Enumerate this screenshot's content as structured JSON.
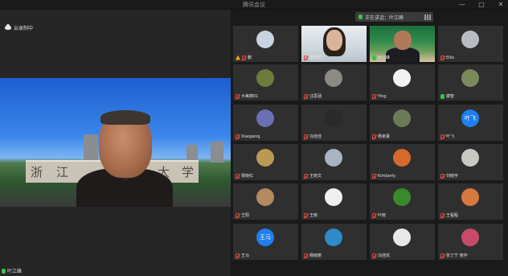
{
  "window": {
    "title": "腾讯会议"
  },
  "recording": {
    "label": "云录制中"
  },
  "self": {
    "name": "叶江峰"
  },
  "speaker": {
    "label": "正在讲话：叶江峰"
  },
  "participants": [
    {
      "name": "鹏",
      "avatar_color": "#c9d2e0",
      "mic": "red",
      "warn": true
    },
    {
      "name": "李晓华",
      "avatar_color": "#d9b39a",
      "mic": "red",
      "video": "woman"
    },
    {
      "name": "叶江峰",
      "avatar_color": "#b07a5a",
      "mic": "green",
      "video": "man"
    },
    {
      "name": "Ellis",
      "avatar_color": "#b8bcc2",
      "mic": "red"
    },
    {
      "name": "大美丽01",
      "avatar_color": "#6c7c3c",
      "mic": "red"
    },
    {
      "name": "汪思涵",
      "avatar_color": "#8d8a86",
      "mic": "red"
    },
    {
      "name": "Ying",
      "avatar_color": "#f2f2f2",
      "mic": "red"
    },
    {
      "name": "康智",
      "avatar_color": "#7a8a5a",
      "mic": "green"
    },
    {
      "name": "Xiaopeng",
      "avatar_color": "#6b6fb3",
      "mic": "red"
    },
    {
      "name": "冯佳佳",
      "avatar_color": "#2a2a2a",
      "mic": "red"
    },
    {
      "name": "杨家豪",
      "avatar_color": "#6b7b5a",
      "mic": "red"
    },
    {
      "name": "叶飞",
      "avatar_color": "#1f7ff0",
      "mic": "red",
      "initials": "叶飞"
    },
    {
      "name": "梁晓红",
      "avatar_color": "#b99a50",
      "mic": "red"
    },
    {
      "name": "王晓文",
      "avatar_color": "#a8b4c4",
      "mic": "red"
    },
    {
      "name": "Kimberly",
      "avatar_color": "#d46a2c",
      "mic": "red"
    },
    {
      "name": "刘晓宇",
      "avatar_color": "#c7c9c2",
      "mic": "red"
    },
    {
      "name": "王阳",
      "avatar_color": "#b58a60",
      "mic": "red"
    },
    {
      "name": "王晓",
      "avatar_color": "#f0f0f0",
      "mic": "red"
    },
    {
      "name": "叶晓",
      "avatar_color": "#3a8a2c",
      "mic": "red"
    },
    {
      "name": "王程程",
      "avatar_color": "#d47a3c",
      "mic": "red"
    },
    {
      "name": "王马",
      "avatar_color": "#1f7ff0",
      "mic": "red",
      "initials": "王马"
    },
    {
      "name": "杨晓丽",
      "avatar_color": "#2f8ac8",
      "mic": "red"
    },
    {
      "name": "冯佳欢",
      "avatar_color": "#e8e8e8",
      "mic": "red"
    },
    {
      "name": "张丁宁 晓宇",
      "avatar_color": "#c84a6a",
      "mic": "red"
    }
  ],
  "window_controls": {
    "minimize": "—",
    "maximize": "□",
    "close": "✕"
  }
}
